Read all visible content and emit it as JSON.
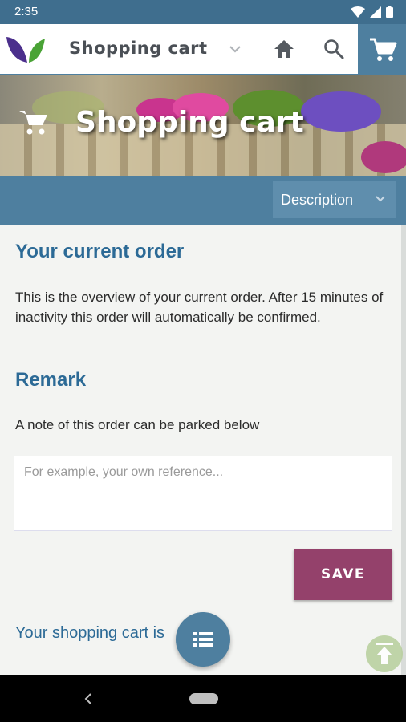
{
  "status_bar": {
    "time": "2:35"
  },
  "app_bar": {
    "title": "Shopping cart",
    "icons": [
      "logo-leaves",
      "chevron-down-icon",
      "home-icon",
      "search-icon",
      "cart-icon"
    ]
  },
  "hero": {
    "title": "Shopping cart",
    "icon": "cart-icon"
  },
  "description_select": {
    "selected": "Description"
  },
  "content": {
    "current_order_heading": "Your current order",
    "overview_text": "This is the overview of your current order. After 15 minutes of inactivity this order will automatically be confirmed.",
    "remark_heading": "Remark",
    "note_text": "A note of this order can be parked below",
    "remark_placeholder": "For example, your own reference...",
    "save_label": "SAVE",
    "cart_status": "Your shopping cart is"
  },
  "colors": {
    "primary": "#4e7f9f",
    "status_bar": "#3f6e8e",
    "heading": "#2c6a96",
    "save_button": "#94416b",
    "scroll_top_button": "#b7cf9c"
  }
}
